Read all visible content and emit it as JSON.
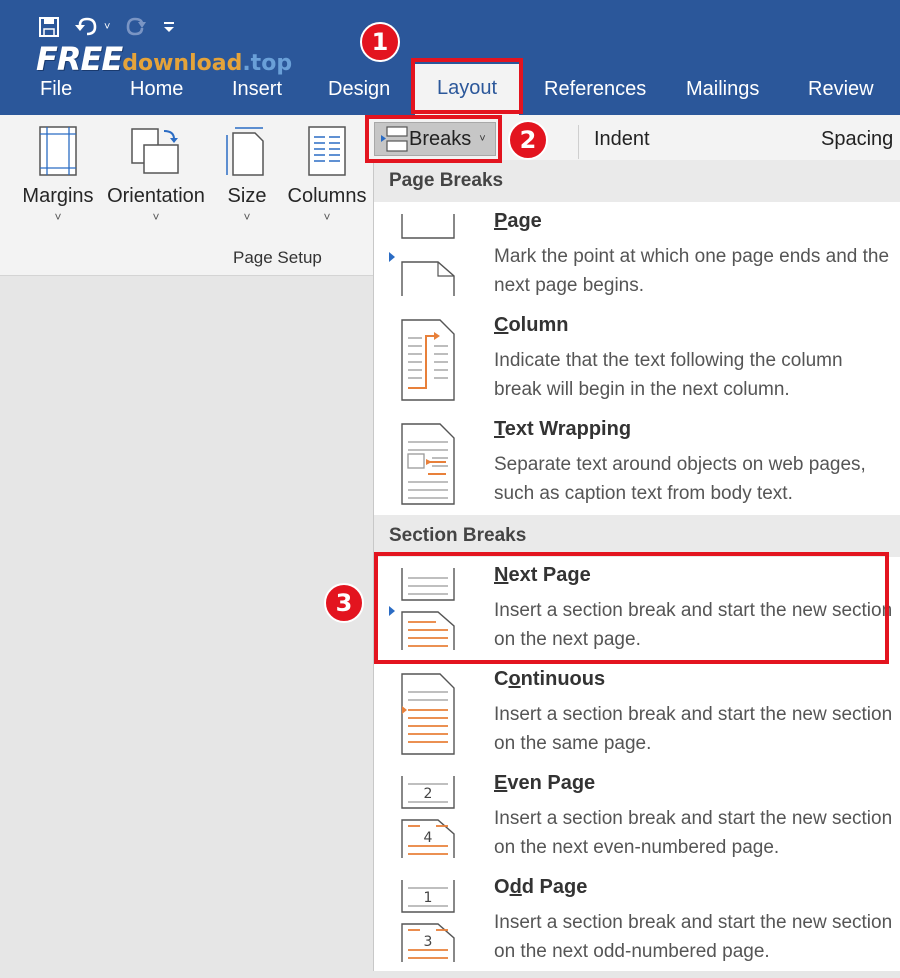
{
  "quick_access": {
    "save_icon": "save-icon",
    "undo_icon": "undo-icon",
    "redo_icon": "redo-icon",
    "customize_icon": "customize-qat-icon"
  },
  "watermark": {
    "free": "FREE",
    "download": "download",
    "top": ".top"
  },
  "tabs": {
    "file": "File",
    "home": "Home",
    "insert": "Insert",
    "design": "Design",
    "layout": "Layout",
    "references": "References",
    "mailings": "Mailings",
    "review": "Review"
  },
  "ribbon": {
    "margins": "Margins",
    "orientation": "Orientation",
    "size": "Size",
    "columns": "Columns",
    "chevron": "˅",
    "group_label": "Page Setup",
    "breaks": "Breaks",
    "indent": "Indent",
    "spacing": "Spacing"
  },
  "menu": {
    "page_breaks_header": "Page Breaks",
    "section_breaks_header": "Section Breaks",
    "items": [
      {
        "key": "P",
        "rest": "age",
        "desc": "Mark the point at which one page ends and the next page begins."
      },
      {
        "key": "C",
        "rest": "olumn",
        "desc": "Indicate that the text following the column break will begin in the next column."
      },
      {
        "key": "T",
        "rest": "ext Wrapping",
        "desc": "Separate text around objects on web pages, such as caption text from body text."
      },
      {
        "key": "N",
        "rest": "ext Page",
        "desc": "Insert a section break and start the new section on the next page."
      },
      {
        "pre": "C",
        "key": "o",
        "rest": "ntinuous",
        "desc": "Insert a section break and start the new section on the same page."
      },
      {
        "key": "E",
        "rest": "ven Page",
        "desc": "Insert a section break and start the new section on the next even-numbered page.",
        "num_top": "2",
        "num_bottom": "4"
      },
      {
        "pre": "O",
        "key": "d",
        "rest": "d Page",
        "desc": "Insert a section break and start the new section on the next odd-numbered page.",
        "num_top": "1",
        "num_bottom": "3"
      }
    ]
  },
  "annotations": {
    "step1": "1",
    "step2": "2",
    "step3": "3"
  },
  "colors": {
    "word_blue": "#2b579a",
    "highlight_red": "#e3141f",
    "accent_orange": "#e8803a"
  }
}
